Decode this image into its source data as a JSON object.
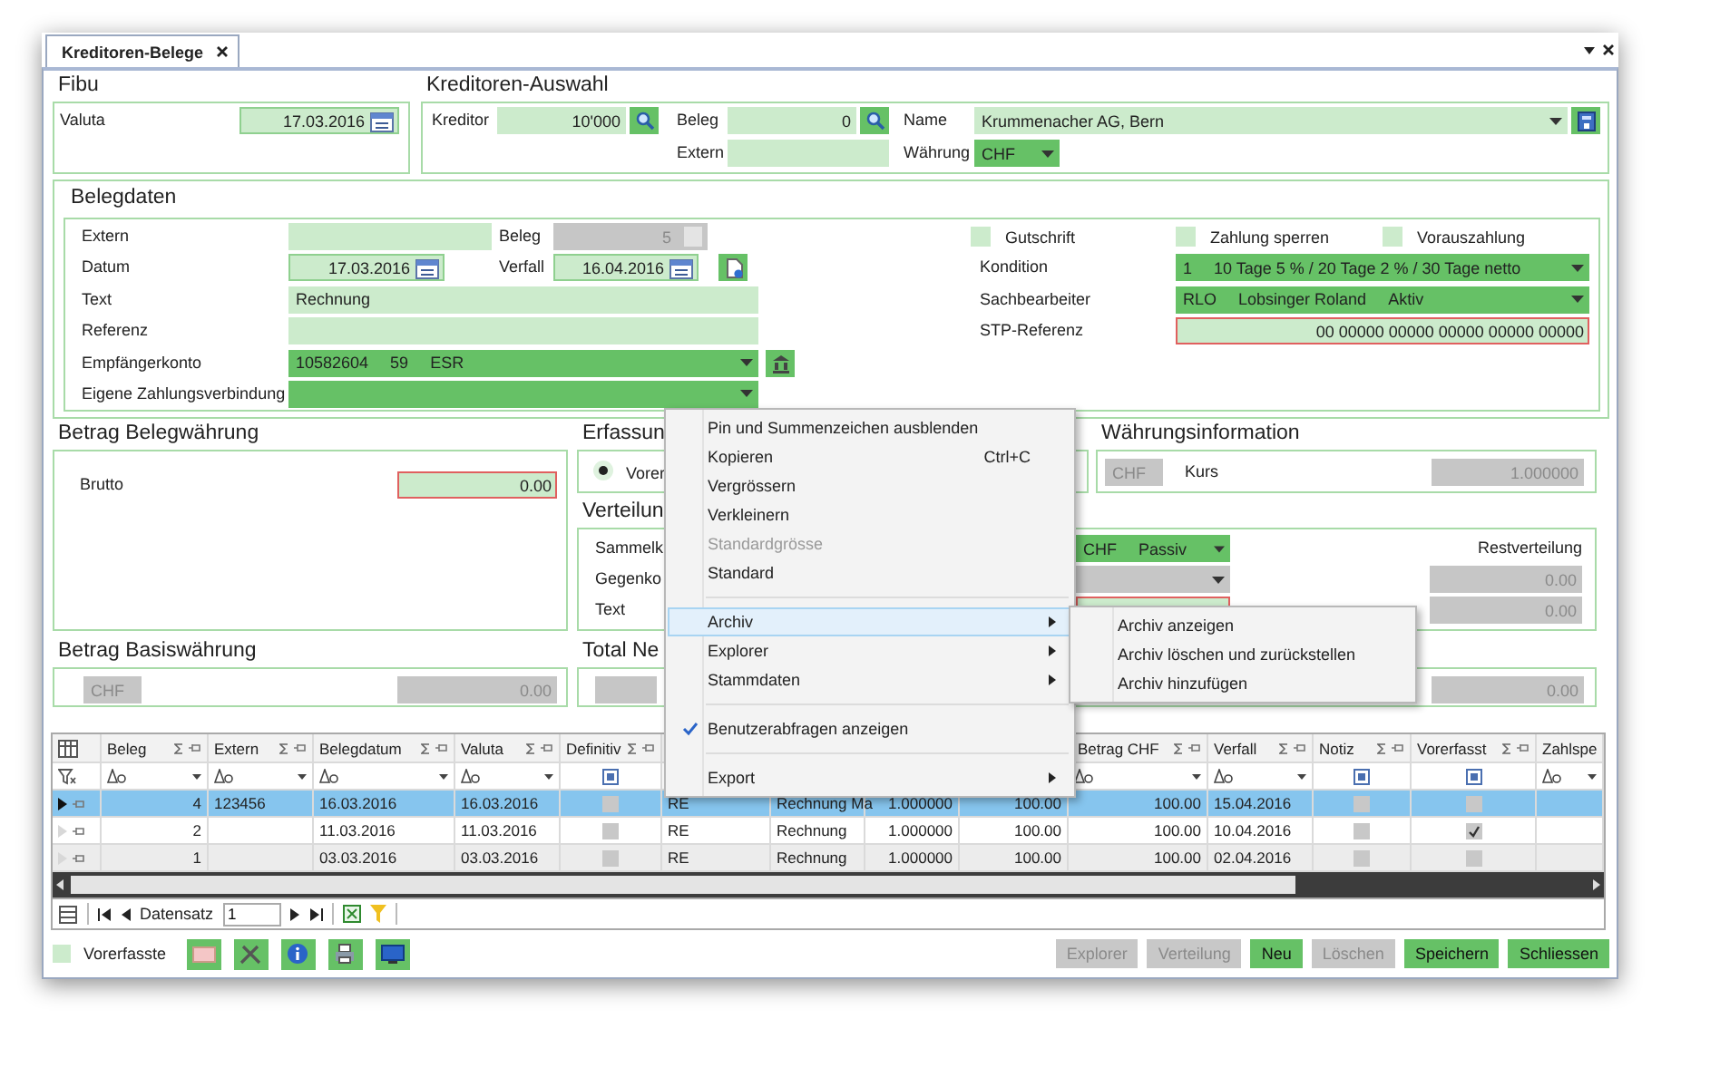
{
  "tab": {
    "label": "Kreditoren-Belege",
    "selected": true
  },
  "fibu": {
    "title": "Fibu",
    "valuta": {
      "label": "Valuta",
      "kind": "date",
      "value": "17.03.2016"
    }
  },
  "kreditoren_auswahl": {
    "title": "Kreditoren-Auswahl",
    "kreditor": {
      "label": "Kreditor",
      "kind": "lookup",
      "value": "10'000"
    },
    "beleg": {
      "label": "Beleg",
      "kind": "lookup",
      "value": "0"
    },
    "extern": {
      "label": "Extern",
      "kind": "text"
    },
    "name": {
      "label": "Name",
      "kind": "combo",
      "value": "Krummenacher AG, Bern"
    },
    "waehrung": {
      "label": "Währung",
      "kind": "select",
      "value": "CHF"
    }
  },
  "belegdaten": {
    "title": "Belegdaten",
    "extern": {
      "label": "Extern",
      "kind": "text"
    },
    "beleg": {
      "label": "Beleg",
      "kind": "number",
      "disabled": true,
      "value": "5"
    },
    "datum": {
      "label": "Datum",
      "kind": "date",
      "value": "17.03.2016"
    },
    "verfall": {
      "label": "Verfall",
      "kind": "date",
      "value": "16.04.2016"
    },
    "text": {
      "label": "Text",
      "kind": "text",
      "value": "Rechnung"
    },
    "referenz": {
      "label": "Referenz",
      "kind": "text"
    },
    "empfaengerkonto": {
      "label": "Empfängerkonto",
      "kind": "select",
      "parts": [
        "10582604",
        "59",
        "ESR"
      ]
    },
    "eigene_zahlungsverbindung": {
      "label": "Eigene Zahlungsverbindung",
      "kind": "select"
    },
    "checkboxes": [
      {
        "label": "Gutschrift",
        "checked": false
      },
      {
        "label": "Zahlung sperren",
        "checked": false
      },
      {
        "label": "Vorauszahlung",
        "checked": false
      }
    ],
    "kondition": {
      "label": "Kondition",
      "kind": "select",
      "parts": [
        "1",
        "10 Tage 5 % / 20 Tage 2 % / 30 Tage netto"
      ]
    },
    "sachbearbeiter": {
      "label": "Sachbearbeiter",
      "kind": "select",
      "parts": [
        "RLO",
        "Lobsinger Roland",
        "Aktiv"
      ]
    },
    "stp_referenz": {
      "label": "STP-Referenz",
      "kind": "number",
      "invalid": true,
      "value": "00 00000 00000 00000 00000 00000"
    }
  },
  "betrag_belegwaehrung": {
    "title": "Betrag Belegwährung",
    "brutto": {
      "label": "Brutto",
      "kind": "number",
      "invalid": true,
      "value": "0.00"
    }
  },
  "erfassung": {
    "title": "Erfassun",
    "option": {
      "label": "Vorer",
      "selected": true
    }
  },
  "waehrungsinformation": {
    "title": "Währungsinformation",
    "waehrung": {
      "kind": "text",
      "disabled": true,
      "value": "CHF"
    },
    "kurs": {
      "label": "Kurs",
      "kind": "number",
      "disabled": true,
      "value": "1.000000"
    }
  },
  "verteilung": {
    "title": "Verteilun",
    "restverteilung_label": "Restverteilung",
    "rows": [
      {
        "label": "Sammelk",
        "field": {
          "kind": "select",
          "parts": [
            "CHF",
            "Passiv"
          ]
        }
      },
      {
        "label": "Gegenko",
        "field": {
          "kind": "select",
          "disabled": true
        },
        "rest": {
          "kind": "number",
          "disabled": true,
          "value": "0.00"
        }
      },
      {
        "label": "Text",
        "field": {
          "kind": "text",
          "invalid": true
        },
        "rest": {
          "kind": "number",
          "disabled": true,
          "value": "0.00"
        }
      }
    ]
  },
  "betrag_basiswaehrung": {
    "title": "Betrag Basiswährung",
    "waehrung": {
      "kind": "text",
      "disabled": true,
      "value": "CHF"
    },
    "betrag": {
      "kind": "number",
      "disabled": true,
      "value": "0.00"
    }
  },
  "total_netto": {
    "title": "Total Ne",
    "field_1": {
      "kind": "text",
      "disabled": true
    },
    "field_2": {
      "kind": "number",
      "disabled": true,
      "value": "0.00"
    }
  },
  "grid": {
    "columns": [
      {
        "label": "Beleg",
        "kind": "number"
      },
      {
        "label": "Extern",
        "kind": "text"
      },
      {
        "label": "Belegdatum",
        "kind": "text"
      },
      {
        "label": "Valuta",
        "kind": "text"
      },
      {
        "label": "Definitiv",
        "kind": "check"
      },
      {
        "kind": "text"
      },
      {
        "kind": "text"
      },
      {
        "kind": "number"
      },
      {
        "kind": "number"
      },
      {
        "label": "Betrag CHF",
        "kind": "number"
      },
      {
        "label": "Verfall",
        "kind": "text"
      },
      {
        "label": "Notiz",
        "kind": "check"
      },
      {
        "label": "Vorerfasst",
        "kind": "check"
      },
      {
        "label": "Zahlspe",
        "kind": "text"
      }
    ],
    "rows": [
      {
        "selected": true,
        "cells": [
          "4",
          "123456",
          "16.03.2016",
          "16.03.2016",
          false,
          "RE",
          "Rechnung Ma",
          "1.000000",
          "100.00",
          "100.00",
          "15.04.2016",
          false,
          false
        ]
      },
      {
        "selected": false,
        "cells": [
          "2",
          null,
          "11.03.2016",
          "11.03.2016",
          false,
          "RE",
          "Rechnung",
          "1.000000",
          "100.00",
          "100.00",
          "10.04.2016",
          false,
          true
        ]
      },
      {
        "selected": false,
        "cells": [
          "1",
          null,
          "03.03.2016",
          "03.03.2016",
          false,
          "RE",
          "Rechnung",
          "1.000000",
          "100.00",
          "100.00",
          "02.04.2016",
          false,
          false
        ]
      }
    ]
  },
  "navigator": {
    "label": "Datensatz",
    "value": "1"
  },
  "legend": {
    "label": "Vorerfasste"
  },
  "buttons": [
    {
      "label": "Explorer",
      "disabled": true
    },
    {
      "label": "Verteilung",
      "disabled": true
    },
    {
      "label": "Neu",
      "disabled": false
    },
    {
      "label": "Löschen",
      "disabled": true
    },
    {
      "label": "Speichern",
      "disabled": false
    },
    {
      "label": "Schliessen",
      "disabled": false
    }
  ],
  "context_menu": {
    "items": [
      {
        "kind": "item",
        "label": "Pin und Summenzeichen ausblenden",
        "selected": false,
        "disabled": false,
        "checked": false,
        "submenu": false
      },
      {
        "kind": "item",
        "label": "Kopieren",
        "shortcut": "Ctrl+C",
        "selected": false,
        "disabled": false,
        "checked": false,
        "submenu": false
      },
      {
        "kind": "item",
        "label": "Vergrössern",
        "selected": false,
        "disabled": false,
        "checked": false,
        "submenu": false
      },
      {
        "kind": "item",
        "label": "Verkleinern",
        "selected": false,
        "disabled": false,
        "checked": false,
        "submenu": false
      },
      {
        "kind": "item",
        "label": "Standardgrösse",
        "selected": false,
        "disabled": true,
        "checked": false,
        "submenu": false
      },
      {
        "kind": "item",
        "label": "Standard",
        "selected": false,
        "disabled": false,
        "checked": false,
        "submenu": false
      },
      {
        "kind": "separator"
      },
      {
        "kind": "item",
        "label": "Archiv",
        "selected": true,
        "disabled": false,
        "checked": false,
        "submenu": true
      },
      {
        "kind": "item",
        "label": "Explorer",
        "selected": false,
        "disabled": false,
        "checked": false,
        "submenu": true
      },
      {
        "kind": "item",
        "label": "Stammdaten",
        "selected": false,
        "disabled": false,
        "checked": false,
        "submenu": true
      },
      {
        "kind": "separator"
      },
      {
        "kind": "item",
        "label": "Benutzerabfragen anzeigen",
        "selected": false,
        "disabled": false,
        "checked": true,
        "submenu": false
      },
      {
        "kind": "separator"
      },
      {
        "kind": "item",
        "label": "Export",
        "selected": false,
        "disabled": false,
        "checked": false,
        "submenu": true
      }
    ]
  },
  "submenu": {
    "items": [
      {
        "kind": "item",
        "label": "Archiv anzeigen",
        "selected": false,
        "disabled": false,
        "checked": false,
        "submenu": false
      },
      {
        "kind": "item",
        "label": "Archiv löschen und zurückstellen",
        "selected": false,
        "disabled": false,
        "checked": false,
        "submenu": false
      },
      {
        "kind": "item",
        "label": "Archiv hinzufügen",
        "selected": false,
        "disabled": false,
        "checked": false,
        "submenu": false
      }
    ]
  }
}
